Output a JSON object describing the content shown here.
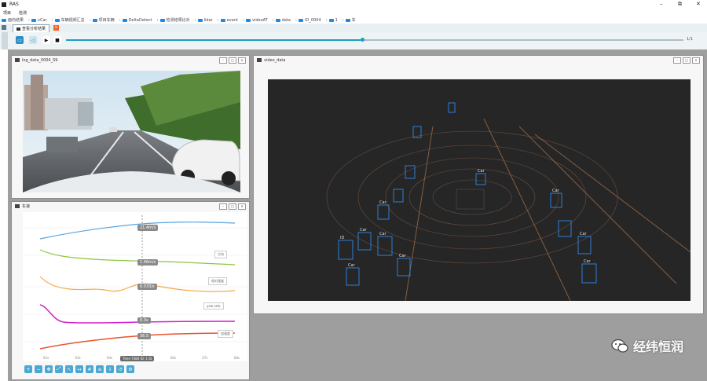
{
  "app": {
    "title": "RAS"
  },
  "menu": {
    "items": [
      "项目",
      "检测"
    ]
  },
  "breadcrumb": [
    "面向结果",
    "vCar",
    "车辆视频汇总",
    "项目车辆",
    "DeltaDetect",
    "检测结果比对",
    "lidar",
    "event",
    "videoAT",
    "data",
    "ID_0004",
    "1",
    "车"
  ],
  "tabs": [
    {
      "label": "查看分析结果",
      "active": true
    }
  ],
  "player": {
    "time_label": "1/1"
  },
  "panels": {
    "video": {
      "title": "log_data_0004_S9"
    },
    "curves": {
      "title": "车速"
    },
    "lidar": {
      "title": "video_data"
    }
  },
  "curve_panel": {
    "value_labels": [
      "21.4m/s",
      "1.46m/s",
      "0.033/s",
      "0.3s",
      "36.5"
    ],
    "legend_entries": [
      "方向",
      "相对速度",
      "yaw rate",
      "加速度"
    ],
    "x_ticks": [
      "62s",
      "63s",
      "64s",
      "65s",
      "66s",
      "67s",
      "68s"
    ],
    "cursor_readout": "Time 7380 ID: 1 ID",
    "colors": {
      "blue": "#5aa3df",
      "green": "#8cc63f",
      "orange": "#f7a84a",
      "magenta": "#d020c8",
      "red": "#e8542e"
    }
  },
  "lidar": {
    "box_labels": [
      "ID",
      "Car",
      "Car",
      "Car",
      "Car",
      "Car",
      "Car",
      "Car",
      "Car",
      "Car"
    ]
  },
  "watermark": {
    "text": "经纬恒润"
  }
}
